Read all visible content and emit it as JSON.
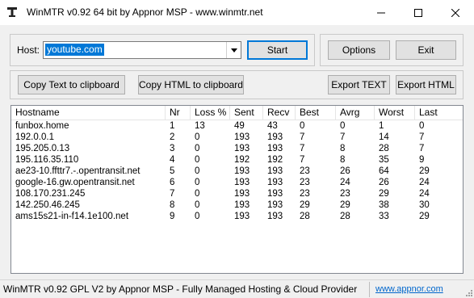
{
  "window": {
    "title": "WinMTR v0.92 64 bit by Appnor MSP - www.winmtr.net"
  },
  "host": {
    "label": "Host:",
    "value": "youtube.com"
  },
  "buttons": {
    "start": "Start",
    "options": "Options",
    "exit": "Exit",
    "copy_text": "Copy Text to clipboard",
    "copy_html": "Copy HTML to clipboard",
    "export_text": "Export TEXT",
    "export_html": "Export HTML"
  },
  "table": {
    "columns": [
      "Hostname",
      "Nr",
      "Loss %",
      "Sent",
      "Recv",
      "Best",
      "Avrg",
      "Worst",
      "Last"
    ],
    "rows": [
      [
        "funbox.home",
        "1",
        "13",
        "49",
        "43",
        "0",
        "0",
        "1",
        "0"
      ],
      [
        "192.0.0.1",
        "2",
        "0",
        "193",
        "193",
        "7",
        "7",
        "14",
        "7"
      ],
      [
        "195.205.0.13",
        "3",
        "0",
        "193",
        "193",
        "7",
        "8",
        "28",
        "7"
      ],
      [
        "195.116.35.110",
        "4",
        "0",
        "192",
        "192",
        "7",
        "8",
        "35",
        "9"
      ],
      [
        "ae23-10.ffttr7.-.opentransit.net",
        "5",
        "0",
        "193",
        "193",
        "23",
        "26",
        "64",
        "29"
      ],
      [
        "google-16.gw.opentransit.net",
        "6",
        "0",
        "193",
        "193",
        "23",
        "24",
        "26",
        "24"
      ],
      [
        "108.170.231.245",
        "7",
        "0",
        "193",
        "193",
        "23",
        "23",
        "29",
        "24"
      ],
      [
        "142.250.46.245",
        "8",
        "0",
        "193",
        "193",
        "29",
        "29",
        "38",
        "30"
      ],
      [
        "ams15s21-in-f14.1e100.net",
        "9",
        "0",
        "193",
        "193",
        "28",
        "28",
        "33",
        "29"
      ]
    ]
  },
  "status": {
    "text": "WinMTR v0.92 GPL V2 by Appnor MSP - Fully Managed Hosting & Cloud Provider",
    "link": "www.appnor.com"
  }
}
